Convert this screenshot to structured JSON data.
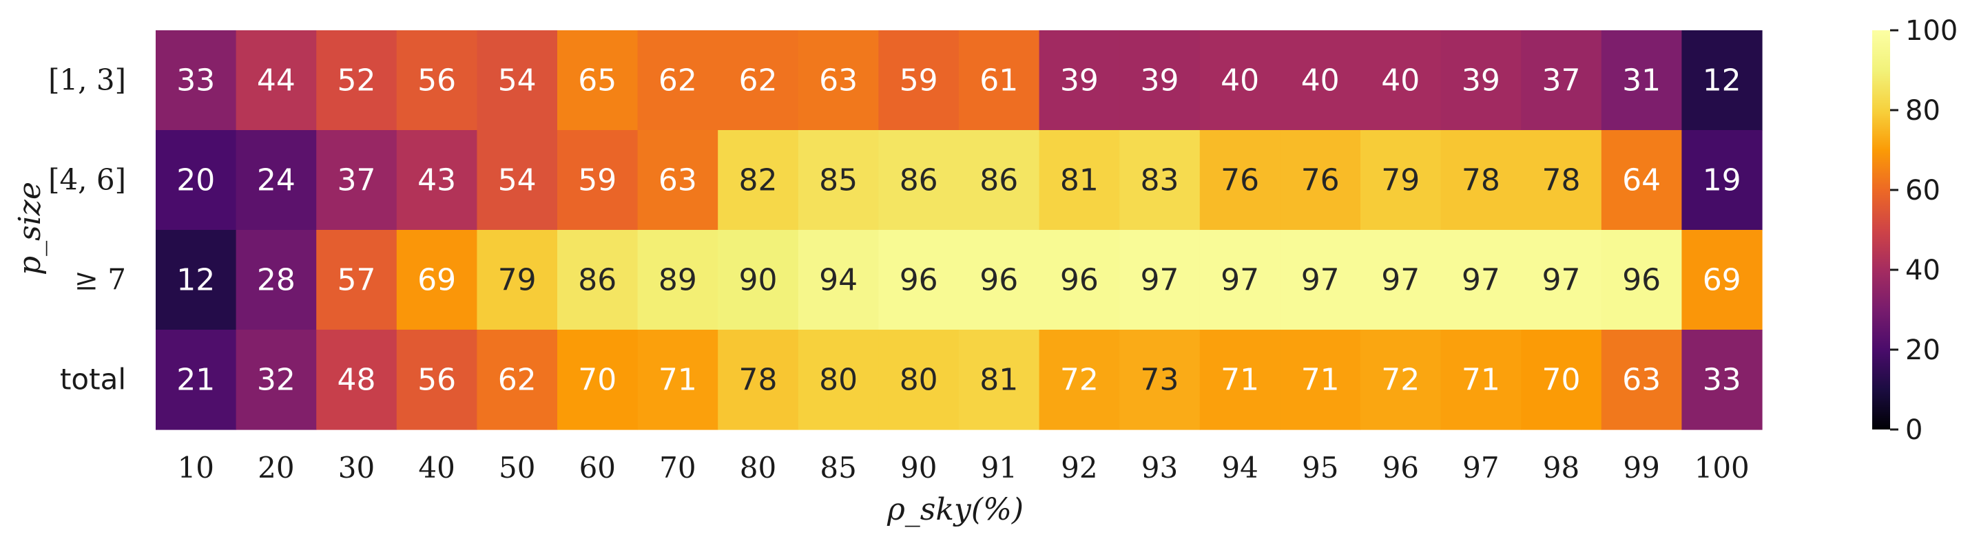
{
  "chart_data": {
    "type": "heatmap",
    "x_categories": [
      "10",
      "20",
      "30",
      "40",
      "50",
      "60",
      "70",
      "80",
      "85",
      "90",
      "91",
      "92",
      "93",
      "94",
      "95",
      "96",
      "97",
      "98",
      "99",
      "100"
    ],
    "y_categories": [
      "[1, 3]",
      "[4, 6]",
      "≥ 7",
      "total"
    ],
    "values": [
      [
        33,
        44,
        52,
        56,
        54,
        65,
        62,
        62,
        63,
        59,
        61,
        39,
        39,
        40,
        40,
        40,
        39,
        37,
        31,
        12
      ],
      [
        20,
        24,
        37,
        43,
        54,
        59,
        63,
        82,
        85,
        86,
        86,
        81,
        83,
        76,
        76,
        79,
        78,
        78,
        64,
        19
      ],
      [
        12,
        28,
        57,
        69,
        79,
        86,
        89,
        90,
        94,
        96,
        96,
        96,
        97,
        97,
        97,
        97,
        97,
        97,
        96,
        69
      ],
      [
        21,
        32,
        48,
        56,
        62,
        70,
        71,
        78,
        80,
        80,
        81,
        72,
        73,
        71,
        71,
        72,
        71,
        70,
        63,
        33
      ]
    ],
    "xlabel": "ρ_sky(%)",
    "ylabel": "p_size",
    "colormap": "inferno",
    "colorbar": {
      "range": [
        0,
        100
      ],
      "ticks": [
        "0",
        "20",
        "40",
        "60",
        "80",
        "100"
      ]
    }
  }
}
